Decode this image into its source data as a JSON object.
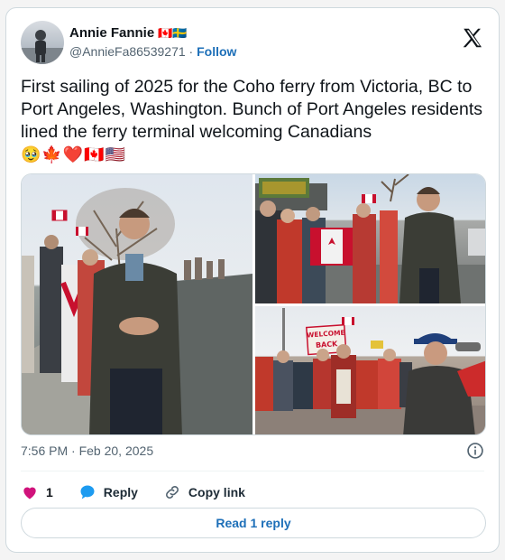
{
  "author": {
    "name": "Annie Fannie",
    "flags": "🇨🇦🇸🇪",
    "handle": "@AnnieFa86539271",
    "separator": "·",
    "follow_label": "Follow"
  },
  "post": {
    "text": "First sailing of 2025 for the Coho ferry from Victoria, BC to Port Angeles, Washington. Bunch of Port Angeles residents lined the ferry terminal welcoming Canadians",
    "emojis": "🥹🍁❤️🇨🇦🇺🇸",
    "sign_text": "WELCOME BACK"
  },
  "meta": {
    "time": "7:56 PM",
    "separator": "·",
    "date": "Feb 20, 2025"
  },
  "actions": {
    "like_count": "1",
    "reply_label": "Reply",
    "copy_label": "Copy link"
  },
  "read_reply_label": "Read 1 reply",
  "colors": {
    "accent": "#1d6fb8",
    "like": "#d0127b",
    "reply_icon": "#1d9bf0",
    "text": "#0f1419",
    "muted": "#536471",
    "border": "#cfd9de"
  },
  "icons": [
    "x-logo-icon",
    "heart-icon",
    "speech-bubble-icon",
    "link-icon",
    "info-icon"
  ]
}
